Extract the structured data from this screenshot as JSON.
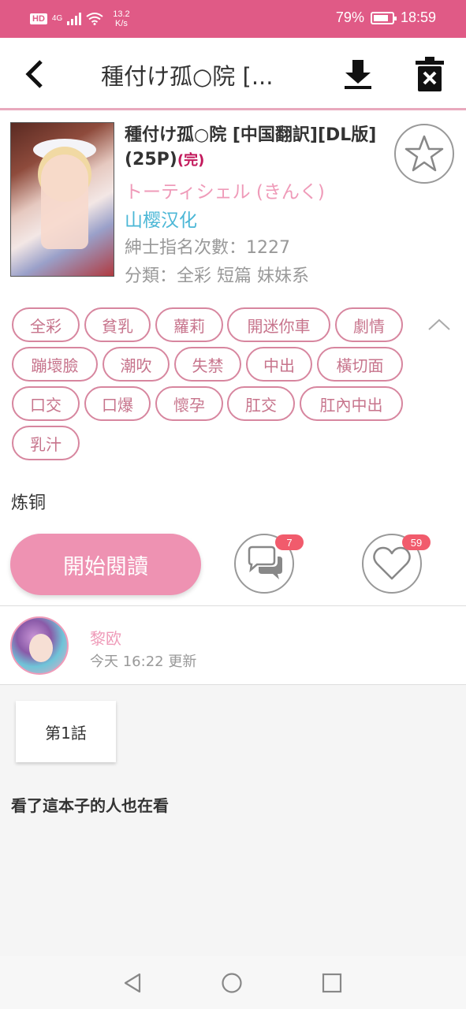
{
  "status_bar": {
    "hd": "HD",
    "network": "4G",
    "speed_value": "13.2",
    "speed_unit": "K/s",
    "battery": "79%",
    "time": "18:59"
  },
  "toolbar": {
    "title": "種付け孤○院 [..."
  },
  "book": {
    "title": "種付け孤○院 [中国翻訳][DL版](25P)",
    "status": "(完)",
    "author": "トーティシェル (きんく)",
    "group": "山樱汉化",
    "favorite_count": "紳士指名次數：1227",
    "category": "分類：全彩 短篇 妹妹系"
  },
  "tags": [
    "全彩",
    "貧乳",
    "蘿莉",
    "開迷你車",
    "劇情",
    "蹦壞臉",
    "潮吹",
    "失禁",
    "中出",
    "橫切面",
    "口交",
    "口爆",
    "懷孕",
    "肛交",
    "肛內中出",
    "乳汁"
  ],
  "uploader": "炼铜",
  "actions": {
    "read_label": "開始閱讀",
    "comment_count": "7",
    "like_count": "59"
  },
  "user": {
    "name": "黎欧",
    "updated": "今天 16:22 更新"
  },
  "chapters": [
    "第1話"
  ],
  "related_title": "看了這本子的人也在看",
  "colors": {
    "accent": "#e05a86",
    "button": "#ee92b2",
    "tag_border": "#d7869f",
    "badge": "#f15b6c"
  }
}
